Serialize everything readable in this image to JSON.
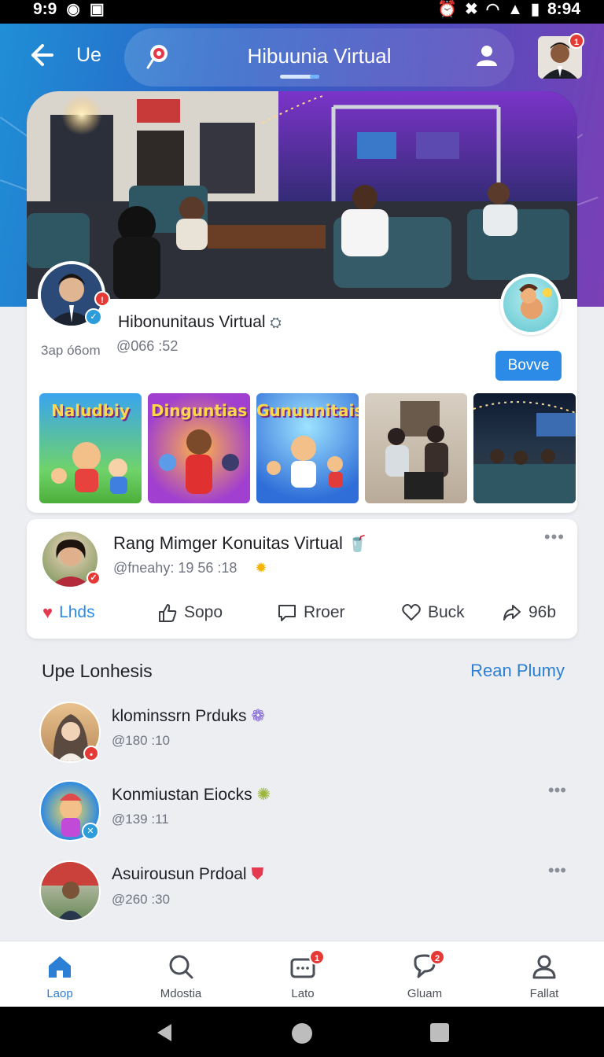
{
  "status_bar": {
    "left_time": "9:9",
    "right_time": "8:94"
  },
  "header": {
    "back_label": "Ue",
    "title": "Hibuunia Virtual"
  },
  "profile": {
    "name": "Hibonunitaus Virtual",
    "handle": "3ap ó6om",
    "time": "@066 :52",
    "follow_label": "Bovve",
    "thumbnails": [
      "Naludbiy",
      "Dinguntias",
      "Gunuunitais"
    ]
  },
  "post": {
    "title": "Rang Mimger Konuitas Virtual",
    "meta": "@fneahy: 19 56 :18",
    "actions": {
      "like": "Lhds",
      "share": "Sopo",
      "comment": "Rroer",
      "save": "Buck",
      "count": "96b"
    }
  },
  "section": {
    "title": "Upe Lonhesis",
    "link": "Rean Plumy"
  },
  "list": [
    {
      "title": "klominssrn Prduks",
      "time": "@180 :10"
    },
    {
      "title": "Konmiustan Eiocks",
      "time": "@139 :11"
    },
    {
      "title": "Asuirousun Prdoal",
      "time": "@260 :30"
    }
  ],
  "bottom_nav": [
    {
      "label": "Laop",
      "active": true
    },
    {
      "label": "Mdostia",
      "active": false
    },
    {
      "label": "Lato",
      "badge": "1",
      "active": false
    },
    {
      "label": "Gluam",
      "badge": "2",
      "active": false
    },
    {
      "label": "Fallat",
      "active": false
    }
  ],
  "top_avatar_badge": "1",
  "colors": {
    "accent": "#2b8be6",
    "header_start": "#1f8fd6",
    "header_end": "#7b3fb5",
    "badge": "#e53935"
  }
}
